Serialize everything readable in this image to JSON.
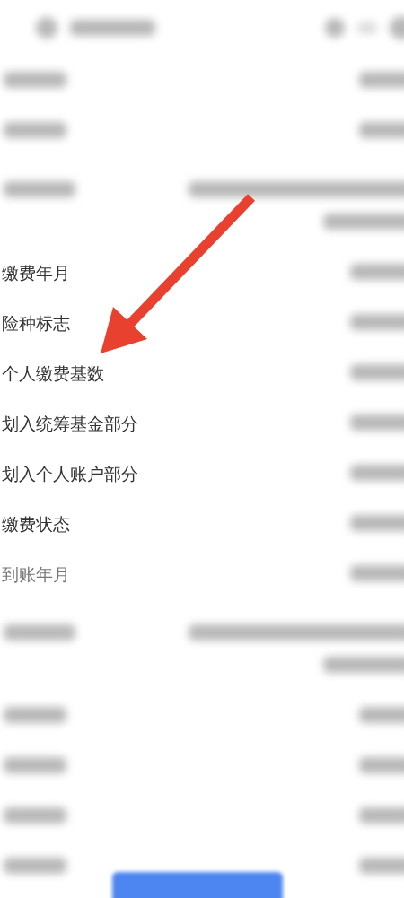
{
  "header": {
    "kind": "blurred"
  },
  "rows": [
    {
      "kind": "blurred"
    },
    {
      "kind": "blurred"
    },
    {
      "kind": "blurred-tall"
    },
    {
      "kind": "labeled",
      "label": "缴费年月"
    },
    {
      "kind": "labeled",
      "label": "险种标志"
    },
    {
      "kind": "labeled",
      "label": "个人缴费基数"
    },
    {
      "kind": "labeled",
      "label": "划入统筹基金部分"
    },
    {
      "kind": "labeled",
      "label": "划入个人账户部分"
    },
    {
      "kind": "labeled",
      "label": "缴费状态"
    },
    {
      "kind": "labeled-faded",
      "label": "到账年月"
    },
    {
      "kind": "blurred-tall"
    },
    {
      "kind": "blurred"
    },
    {
      "kind": "blurred"
    },
    {
      "kind": "blurred"
    },
    {
      "kind": "blurred"
    }
  ],
  "annotation": {
    "kind": "arrow",
    "color": "#e8412f"
  }
}
